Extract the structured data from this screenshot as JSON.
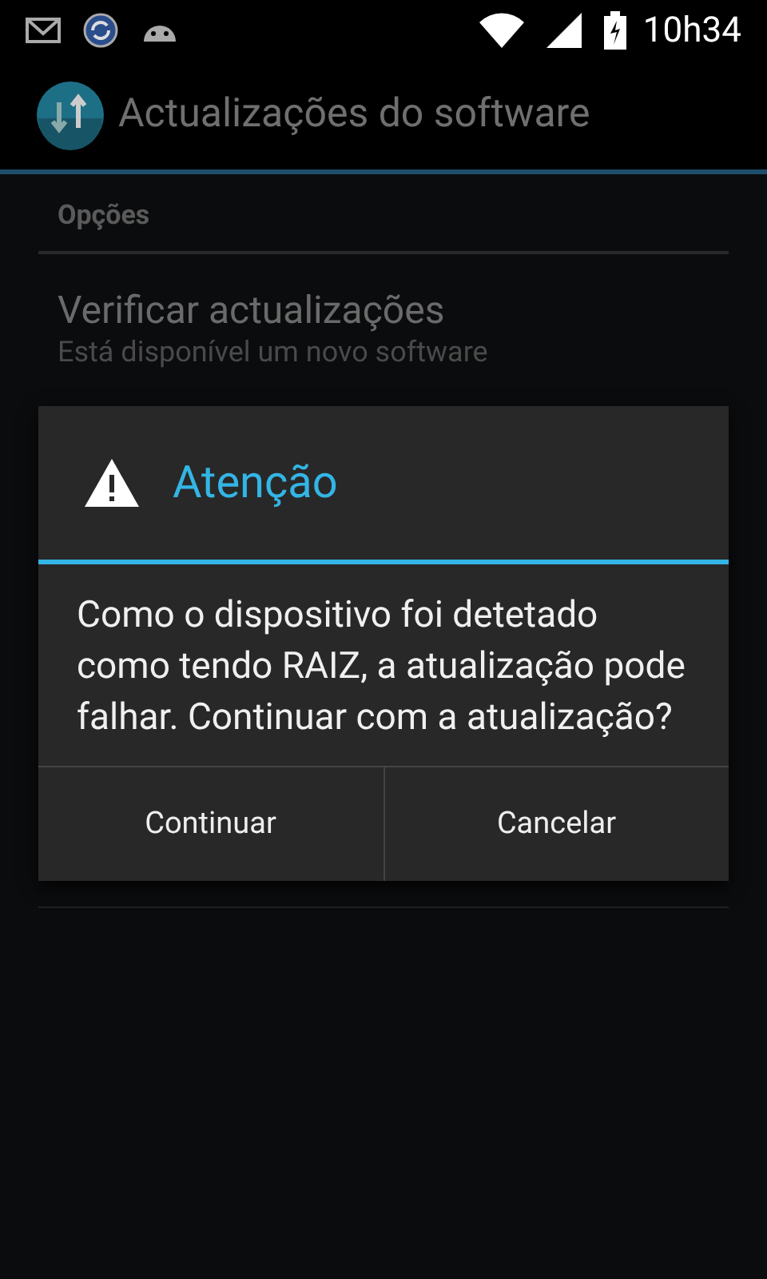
{
  "status_bar": {
    "time": "10h34"
  },
  "action_bar": {
    "title": "Actualizações do software"
  },
  "section": {
    "header": "Opções"
  },
  "preferences": [
    {
      "title": "Verificar actualizações",
      "summary": "Está disponível um novo software"
    }
  ],
  "dialog": {
    "title": "Atenção",
    "message": "Como o dispositivo foi detetado como tendo RAIZ, a atualização pode falhar. Continuar com a atualização?",
    "buttons": [
      "Continuar",
      "Cancelar"
    ]
  }
}
